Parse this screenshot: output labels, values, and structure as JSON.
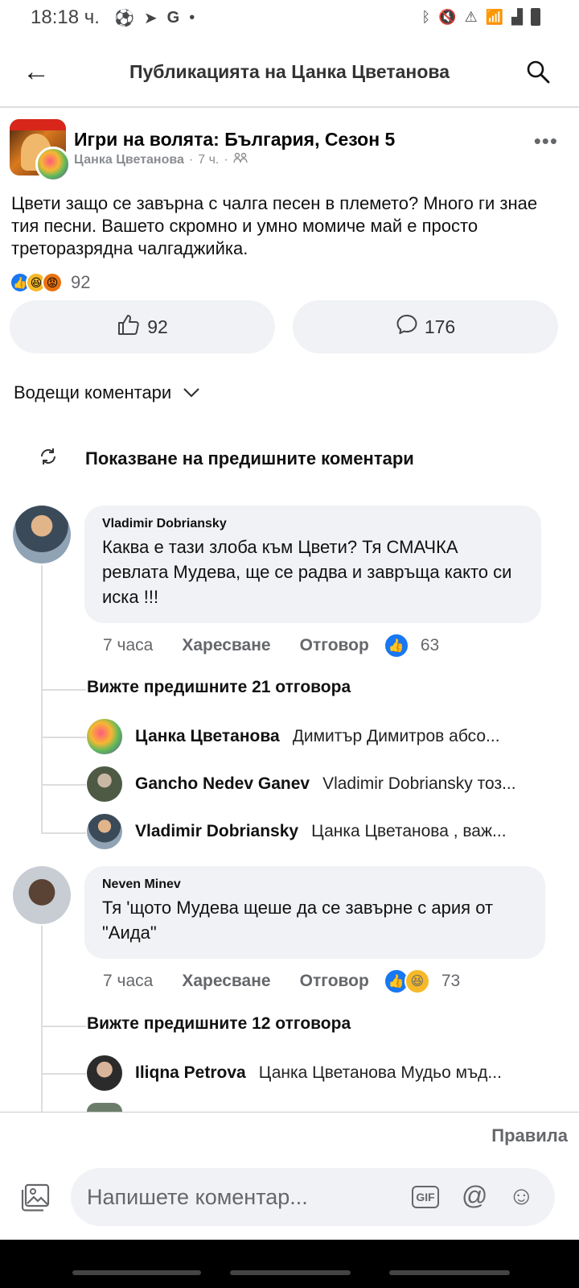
{
  "status_bar": {
    "time": "18:18 ч.",
    "left_icons": [
      "soccer-icon",
      "telegram-icon",
      "google-icon",
      "dot-icon"
    ],
    "right_icons": [
      "bluetooth-icon",
      "mute-icon",
      "battery-saver-icon",
      "wifi-icon",
      "signal-icon",
      "battery-icon"
    ]
  },
  "top_bar": {
    "title": "Публикацията на Цанка Цветанова"
  },
  "post": {
    "group_name": "Игри на волята: България, Сезон 5",
    "author": "Цанка Цветанова",
    "time": "7 ч.",
    "text": "Цвети защо се завърна с чалга песен в племето? Много ги знае тия песни. Вашето скромно и умно момиче май е просто треторазрядна чалгаджийка.",
    "reaction_count": "92",
    "like_count": "92",
    "comment_count": "176"
  },
  "sort_label": "Водещи коментари",
  "prev_comments_label": "Показване на предишните коментари",
  "comments": [
    {
      "author": "Vladimir Dobriansky",
      "text": "Каква е тази злоба към Цвети? Тя СМАЧКА ревлата Мудева, ще се радва и завръща както си иска !!!",
      "time": "7 часа",
      "like_label": "Харесване",
      "reply_label": "Отговор",
      "reactions": "63",
      "see_more": "Вижте предишните 21 отговора",
      "replies": [
        {
          "name": "Цанка Цветанова",
          "text": "Димитър Димитров абсо..."
        },
        {
          "name": "Gancho Nedev Ganev",
          "text": "Vladimir Dobriansky тоз..."
        },
        {
          "name": "Vladimir Dobriansky",
          "text": "Цанка Цветанова , важ..."
        }
      ]
    },
    {
      "author": "Neven Minev",
      "text": "Тя 'щото Мудева щеше да се завърне с ария от \"Аида\"",
      "time": "7 часа",
      "like_label": "Харесване",
      "reply_label": "Отговор",
      "reactions": "73",
      "see_more": "Вижте предишните 12 отговора",
      "replies": [
        {
          "name": "Iliqna Petrova",
          "text": "Цанка Цветанова Мудьо мъд..."
        }
      ]
    }
  ],
  "bottom": {
    "rules_label": "Правила",
    "input_placeholder": "Напишете коментар...",
    "gif_label": "GIF"
  },
  "colors": {
    "accent": "#1877f2",
    "bubble": "#f0f2f5",
    "muted": "#65676b"
  }
}
